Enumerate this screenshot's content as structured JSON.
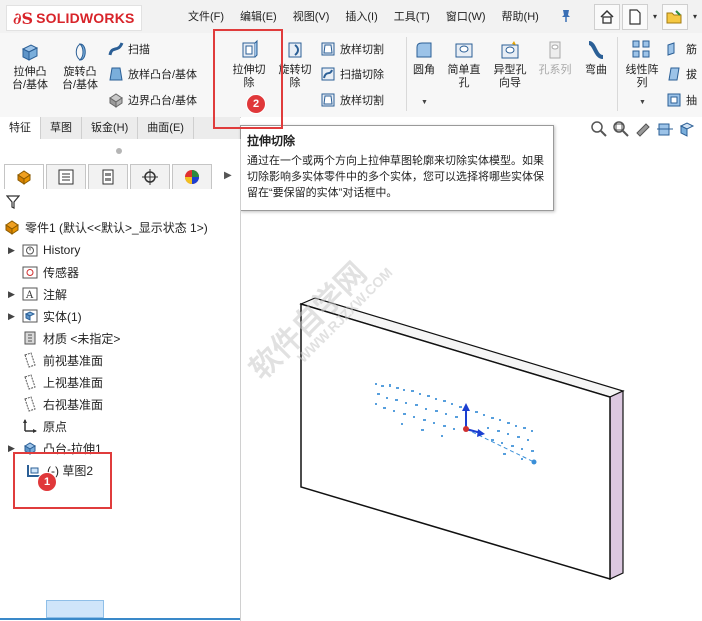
{
  "app": {
    "logo_ds": "∂S",
    "logo_text": "SOLIDWORKS"
  },
  "menu": [
    "文件(F)",
    "编辑(E)",
    "视图(V)",
    "插入(I)",
    "工具(T)",
    "窗口(W)",
    "帮助(H)"
  ],
  "ribbon": {
    "extrude_boss": [
      "拉伸凸",
      "台/基体"
    ],
    "revolve_boss": [
      "旋转凸",
      "台/基体"
    ],
    "sweep": "扫描",
    "loft_boss": "放样凸台/基体",
    "boundary_boss": "边界凸台/基体",
    "extrude_cut": [
      "拉伸切",
      "除"
    ],
    "revolve_cut": [
      "旋转切",
      "除"
    ],
    "loft_cut_1": "放样切割",
    "sweep_cut": "扫描切除",
    "loft_cut_2": "放样切割",
    "fillet": "圆角",
    "simple_hole": [
      "简单直",
      "孔"
    ],
    "hole_wizard": [
      "异型孔",
      "向导"
    ],
    "hole_series": "孔系列",
    "bend": "弯曲",
    "linear_pattern": [
      "线性阵",
      "列"
    ],
    "rib_partial": "筋",
    "draft_partial": "拔",
    "shell_partial": "抽"
  },
  "tabs": [
    "特征",
    "草图",
    "钣金(H)",
    "曲面(E)"
  ],
  "tooltip": {
    "title": "拉伸切除",
    "body": "通过在一个或两个方向上拉伸草图轮廓来切除实体模型。如果切除影响多实体零件中的多个实体，您可以选择将哪些实体保留在“要保留的实体”对话框中。"
  },
  "tree": {
    "root": "零件1 (默认<<默认>_显示状态 1>)",
    "items": [
      "History",
      "传感器",
      "注解",
      "实体(1)",
      "材质 <未指定>",
      "前视基准面",
      "上视基准面",
      "右视基准面",
      "原点",
      "凸台-拉伸1",
      "(-) 草图2"
    ]
  },
  "badges": {
    "one": "1",
    "two": "2"
  },
  "watermark": [
    "软件自学网",
    "WWW.RJZXW.COM"
  ]
}
